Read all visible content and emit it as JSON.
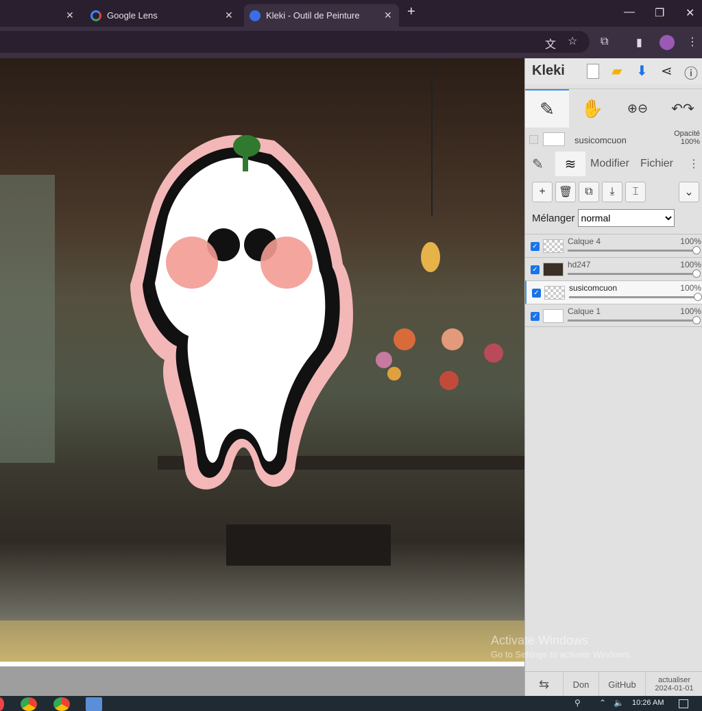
{
  "browser": {
    "tabs": [
      {
        "label": "Google Lens",
        "active": false
      },
      {
        "label": "Kleki - Outil de Peinture",
        "active": true
      }
    ],
    "new_tab_symbol": "+"
  },
  "kleki": {
    "logo": "Kleki",
    "current_layer": {
      "name": "susicomcuon",
      "opacity_label": "Opacité",
      "opacity_value": "100%"
    },
    "panel_tabs": [
      "Modifier",
      "Fichier"
    ],
    "blend": {
      "label": "Mélanger",
      "value": "normal"
    },
    "layers": [
      {
        "name": "Calque 4",
        "opacity": "100%",
        "checked": true,
        "selected": false
      },
      {
        "name": "hd247",
        "opacity": "100%",
        "checked": true,
        "selected": false
      },
      {
        "name": "susicomcuon",
        "opacity": "100%",
        "checked": true,
        "selected": true
      },
      {
        "name": "Calque 1",
        "opacity": "100%",
        "checked": true,
        "selected": false
      }
    ],
    "footer": {
      "don": "Don",
      "github": "GitHub",
      "update_line1": "actualiser",
      "update_line2": "2024-01-01"
    }
  },
  "watermark": {
    "line1": "Activate Windows",
    "line2": "Go to Settings to activate Windows."
  },
  "taskbar": {
    "time": "10:26 AM"
  }
}
